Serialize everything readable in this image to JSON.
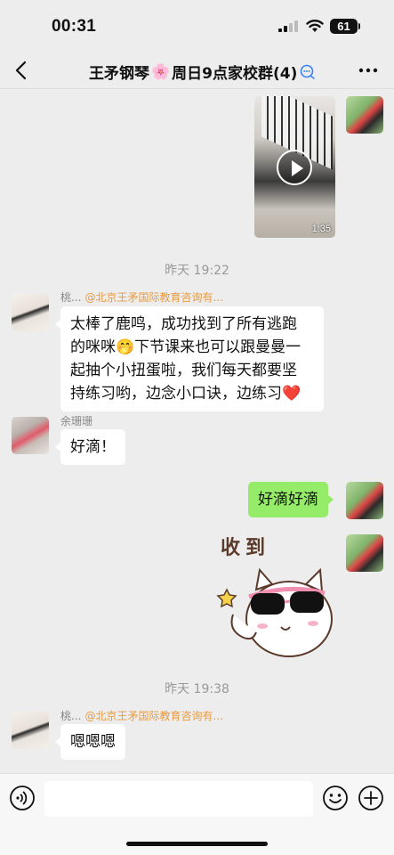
{
  "status_bar": {
    "time": "00:31",
    "battery": "61"
  },
  "header": {
    "title_part1": "王矛钢琴",
    "title_flower": "🌸",
    "title_part2": "周日9点家校群(4)",
    "back_icon": "chevron-left-icon",
    "more_icon": "more-dots-icon"
  },
  "messages": {
    "video": {
      "duration": "1:35"
    },
    "time1": "昨天 19:22",
    "msg1": {
      "sender": "桃...",
      "org": "@北京王矛国际教育咨询有...",
      "line1": "太棒了鹿鸣，成功找到了所有逃跑",
      "line2": "的咪咪🤭下节课来也可以跟曼曼一",
      "line3": "起抽个小扭蛋啦，我们每天都要坚",
      "line4": "持练习哟，边念小口诀，边练习❤️"
    },
    "msg2": {
      "sender": "余珊珊",
      "text": "好滴！"
    },
    "msg3": {
      "text": "好滴好滴"
    },
    "sticker": {
      "text": "收到"
    },
    "time2": "昨天 19:38",
    "msg4": {
      "sender": "桃...",
      "org": "@北京王矛国际教育咨询有...",
      "text": "嗯嗯嗯"
    }
  },
  "input": {
    "placeholder": "",
    "value": ""
  },
  "colors": {
    "self_bubble": "#95ec69",
    "other_bubble": "#ffffff",
    "background": "#ededed",
    "mention": "#e99a3d"
  }
}
